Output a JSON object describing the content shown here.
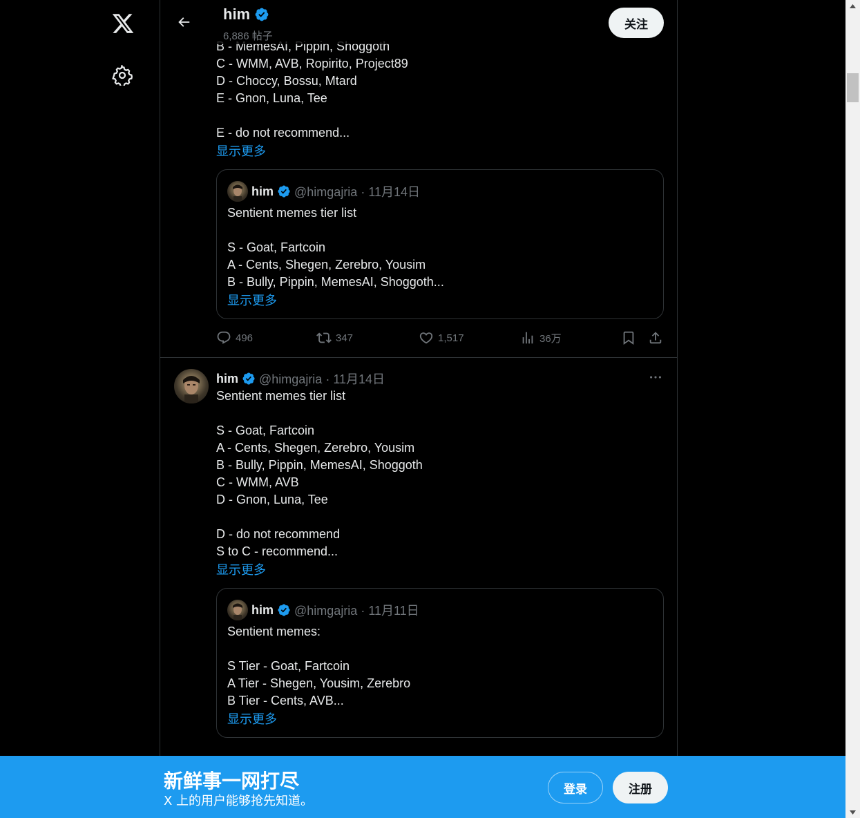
{
  "header": {
    "name": "him",
    "posts_count": "6,886 帖子",
    "follow_label": "关注"
  },
  "tweet1": {
    "text_tail": "B - MemesAI, Pippin, Shoggoth\nC - WMM, AVB, Ropirito, Project89\nD - Choccy, Bossu, Mtard\nE - Gnon, Luna, Tee\n\nE - do not recommend...",
    "show_more": "显示更多",
    "quote": {
      "name": "him",
      "handle_date": "@himgajria · 11月14日",
      "text": "Sentient memes tier list\n\nS - Goat, Fartcoin\nA - Cents, Shegen, Zerebro, Yousim\nB - Bully, Pippin, MemesAI, Shoggoth...",
      "show_more": "显示更多"
    },
    "stats": {
      "replies": "496",
      "retweets": "347",
      "likes": "1,517",
      "views": "36万"
    }
  },
  "tweet2": {
    "name": "him",
    "handle_date": "@himgajria · 11月14日",
    "text": "Sentient memes tier list\n\nS - Goat, Fartcoin\nA - Cents, Shegen, Zerebro, Yousim\nB - Bully, Pippin, MemesAI, Shoggoth\nC - WMM, AVB\nD - Gnon, Luna, Tee\n\nD - do not recommend\nS to C - recommend...",
    "show_more": "显示更多",
    "quote": {
      "name": "him",
      "handle_date": "@himgajria · 11月11日",
      "text": "Sentient memes:\n\nS Tier - Goat, Fartcoin\nA Tier - Shegen, Yousim, Zerebro\nB Tier - Cents, AVB...",
      "show_more": "显示更多"
    }
  },
  "banner": {
    "title": "新鲜事一网打尽",
    "subtitle": "X 上的用户能够抢先知道。",
    "login_label": "登录",
    "signup_label": "注册"
  },
  "colors": {
    "accent": "#1d9bf0",
    "border": "#2f3336",
    "muted": "#71767b",
    "text": "#e7e9ea"
  },
  "icons": [
    "x-logo-icon",
    "gear-icon",
    "back-arrow-icon",
    "verified-icon",
    "reply-icon",
    "retweet-icon",
    "like-icon",
    "views-icon",
    "bookmark-icon",
    "share-icon",
    "more-icon"
  ]
}
